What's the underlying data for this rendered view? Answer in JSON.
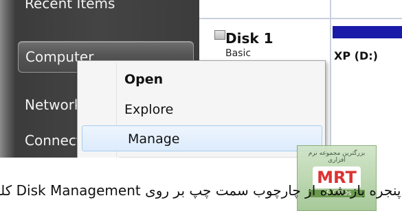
{
  "start_menu": {
    "items": [
      {
        "label": "Recent Items"
      },
      {
        "label": "Computer"
      },
      {
        "label": "Network"
      },
      {
        "label": "Connect To"
      }
    ]
  },
  "background_window": {
    "disk_label": "Disk 1",
    "partial_text": "Basic",
    "volume_label": "XP (D:)"
  },
  "context_menu": {
    "items": [
      {
        "label": "Open",
        "bold": true
      },
      {
        "label": "Explore"
      },
      {
        "label": "Manage",
        "highlighted": true
      }
    ]
  },
  "watermark": {
    "line1": "بزرگترین مجموعه نرم افزاری",
    "line2": "",
    "logo": "MRT",
    "sub": "25 DVDs"
  },
  "caption": {
    "text": "از پنجره باز شده از چارچوب سمت چپ بر روی Disk Management کلیک کنید"
  }
}
